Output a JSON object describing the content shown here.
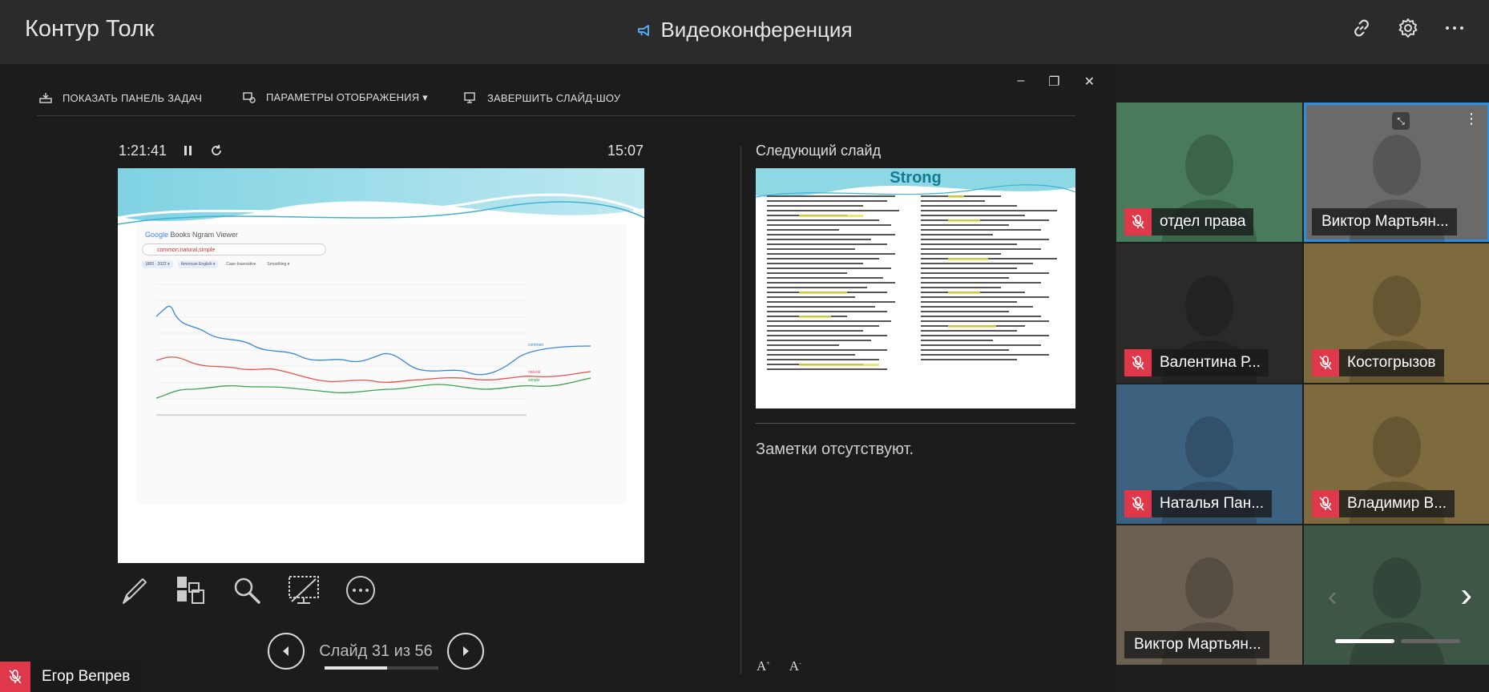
{
  "app": {
    "brand": "Контур Толк",
    "title": "Видеоконференция"
  },
  "toolbar": {
    "show_taskbar": "ПОКАЗАТЬ ПАНЕЛЬ ЗАДАЧ",
    "display_settings": "ПАРАМЕТРЫ ОТОБРАЖЕНИЯ ▾",
    "end_slideshow": "ЗАВЕРШИТЬ СЛАЙД-ШОУ"
  },
  "presenter": {
    "elapsed": "1:21:41",
    "clock": "15:07",
    "next_slide_label": "Следующий слайд",
    "notes": "Заметки отсутствуют.",
    "slide_counter": "Слайд 31 из 56",
    "progress": 0.55
  },
  "current_slide": {
    "ngram_title": "Books Ngram Viewer",
    "google": "Google",
    "query": "common,natural,simple",
    "chips": [
      "1800 - 2022 ▾",
      "American English ▾",
      "Case-Insensitive",
      "Smoothing ▾"
    ],
    "series": [
      "common",
      "natural",
      "simple"
    ],
    "series_colors": [
      "#3b86d6",
      "#e0544c",
      "#3aa14a"
    ]
  },
  "next_slide": {
    "title": "Strong"
  },
  "self": {
    "name": "Егор Вепрев"
  },
  "participants": [
    {
      "name": "отдел права",
      "muted": true,
      "bg": "#4a7a5c"
    },
    {
      "name": "Виктор Мартьян...",
      "muted": false,
      "bg": "#6a6a6a",
      "active": true
    },
    {
      "name": "Валентина Р...",
      "muted": true,
      "bg": "#2c2a28"
    },
    {
      "name": "Костогрызов",
      "muted": true,
      "bg": "#7d6a3e"
    },
    {
      "name": "Наталья Пан...",
      "muted": true,
      "bg": "#3d6280"
    },
    {
      "name": "Владимир В...",
      "muted": true,
      "bg": "#7d6a3e"
    },
    {
      "name": "Виктор Мартьян...",
      "muted": false,
      "bg": "#6b6052"
    },
    {
      "name": "",
      "muted": false,
      "bg": "#3d5646"
    }
  ]
}
